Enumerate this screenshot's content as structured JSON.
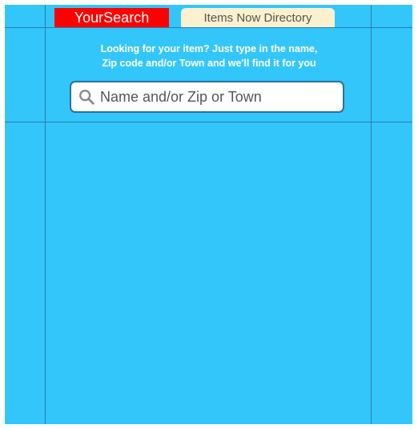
{
  "tabs": {
    "active_label": "YourSearch",
    "inactive_label": "Items Now Directory"
  },
  "intro": {
    "text": "Looking for your item? Just type in the name,\nZip code and/or Town and we'll find it for you"
  },
  "search": {
    "placeholder": "Name and/or Zip or Town",
    "value": ""
  },
  "colors": {
    "background": "#33c6fb",
    "active_tab": "#ff0000",
    "inactive_tab": "#fbf1cf",
    "input_border": "#2f6f96"
  },
  "icons": {
    "search": "search-icon"
  }
}
